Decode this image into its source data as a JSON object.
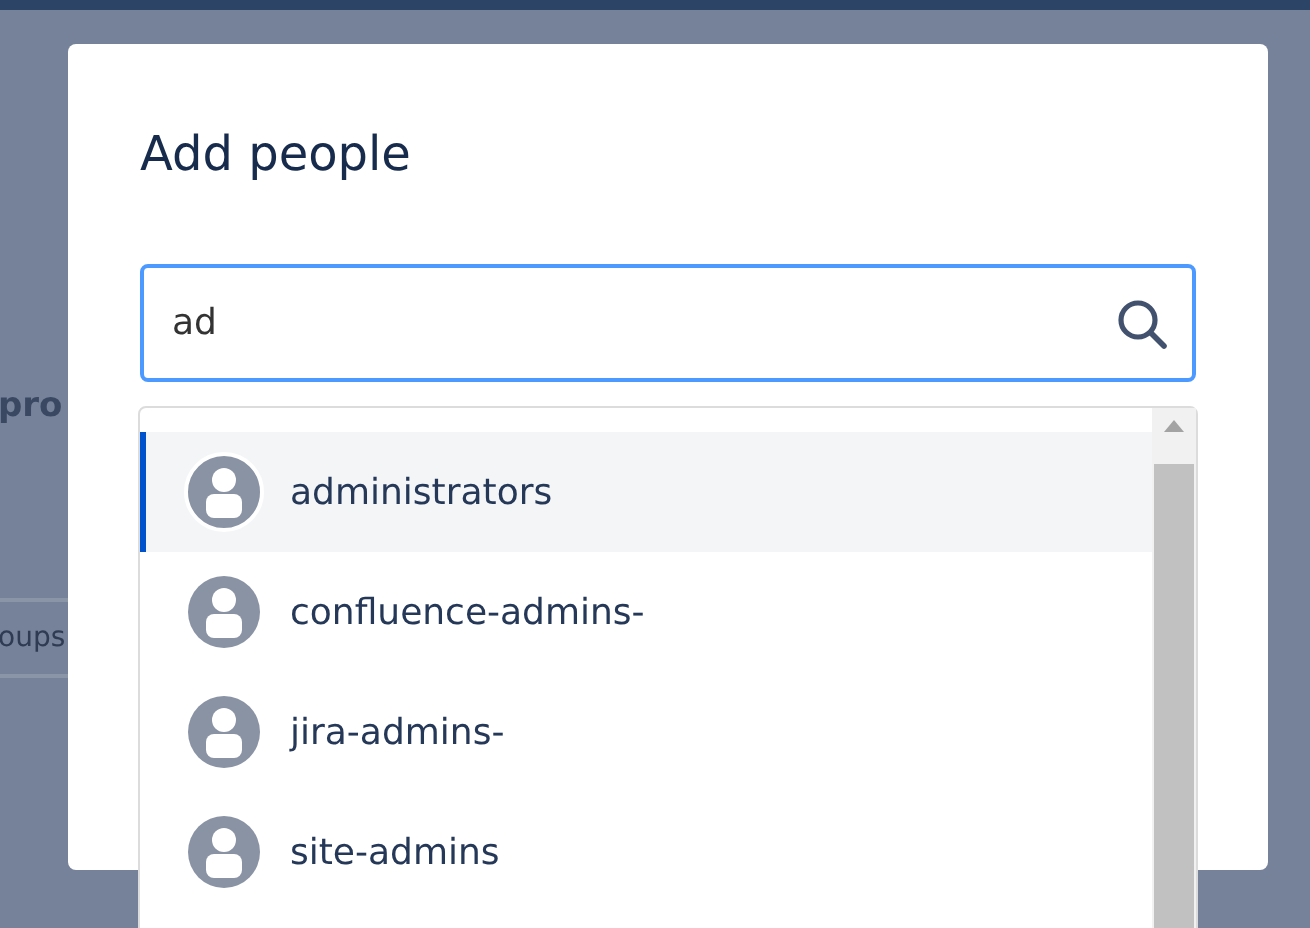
{
  "background": {
    "heading_fragment": "pro",
    "button_fragment": "oups"
  },
  "dialog": {
    "title": "Add people",
    "search": {
      "value": "ad"
    },
    "results": [
      {
        "name": "administrators",
        "selected": true
      },
      {
        "name": "confluence-admins-",
        "selected": false
      },
      {
        "name": "jira-admins-",
        "selected": false
      },
      {
        "name": "site-admins",
        "selected": false
      }
    ]
  }
}
